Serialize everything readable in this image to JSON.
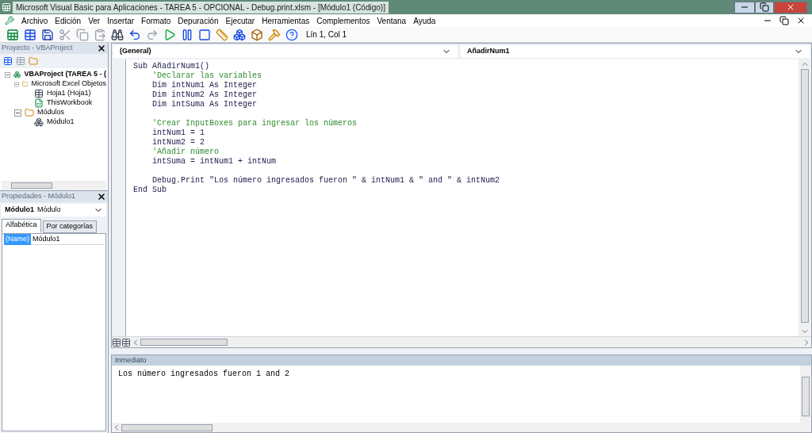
{
  "window": {
    "title": "Microsoft Visual Basic para Aplicaciones - TAREA 5 - OPCIONAL - Debug.print.xlsm - [Módulo1 (Código)]"
  },
  "menu": [
    "Archivo",
    "Edición",
    "Ver",
    "Insertar",
    "Formato",
    "Depuración",
    "Ejecutar",
    "Herramientas",
    "Complementos",
    "Ventana",
    "Ayuda"
  ],
  "toolbar": {
    "position": "Lín 1, Col 1"
  },
  "project_panel": {
    "title": "Proyecto - VBAProject",
    "tree": [
      {
        "label": "VBAProject (TAREA 5 - (",
        "kind": "project",
        "expanded": true,
        "children": [
          {
            "label": "Microsoft Excel Objetos",
            "kind": "folder",
            "expanded": true,
            "children": [
              {
                "label": "Hoja1 (Hoja1)",
                "kind": "sheet"
              },
              {
                "label": "ThisWorkbook",
                "kind": "workbook"
              }
            ]
          },
          {
            "label": "Módulos",
            "kind": "folder",
            "expanded": true,
            "children": [
              {
                "label": "Módulo1",
                "kind": "module"
              }
            ]
          }
        ]
      }
    ]
  },
  "properties_panel": {
    "title": "Propiedades - Módulo1",
    "object": "Módulo1",
    "object_type": "Módulo",
    "tabs": [
      {
        "label": "Alfabética",
        "selected": true
      },
      {
        "label": "Por categorías",
        "selected": false
      }
    ],
    "rows": [
      {
        "name": "(Name)",
        "value": "Módulo1",
        "selected": true
      }
    ]
  },
  "code_window": {
    "object_combo": "(General)",
    "procedure_combo": "AñadirNum1",
    "lines": [
      {
        "kind": "code",
        "text": "Sub AñadirNum1()"
      },
      {
        "kind": "comment",
        "text": "    'Declarar las variables"
      },
      {
        "kind": "code",
        "text": "    Dim intNum1 As Integer"
      },
      {
        "kind": "code",
        "text": "    Dim intNum2 As Integer"
      },
      {
        "kind": "code",
        "text": "    Dim intSuma As Integer"
      },
      {
        "kind": "blank"
      },
      {
        "kind": "comment",
        "text": "    'Crear InputBoxes para ingresar los números"
      },
      {
        "kind": "code",
        "text": "    intNum1 = 1"
      },
      {
        "kind": "code",
        "text": "    intNum2 = 2"
      },
      {
        "kind": "comment",
        "text": "    'Añadir número"
      },
      {
        "kind": "code",
        "text": "    intSuma = intNum1 + intNum"
      },
      {
        "kind": "blank"
      },
      {
        "kind": "code",
        "text": "    Debug.Print \"Los número ingresados fueron \" & intNum1 & \" and \" & intNum2"
      },
      {
        "kind": "code",
        "text": "End Sub"
      }
    ]
  },
  "immediate": {
    "title": "Inmediato",
    "output": "Los número ingresados fueron 1 and 2"
  }
}
